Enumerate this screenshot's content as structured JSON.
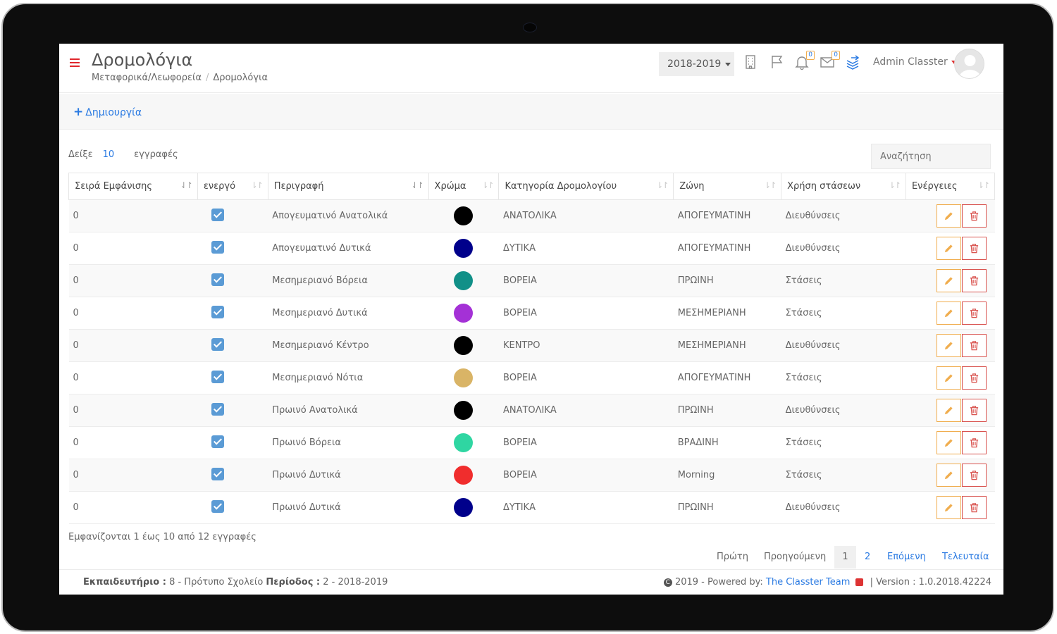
{
  "header": {
    "title": "Δρομολόγια",
    "breadcrumb": [
      "Μεταφορικά/Λεωφορεία",
      "Δρομολόγια"
    ],
    "year": "2018-2019",
    "notifications_count": "0",
    "messages_count": "0",
    "user_name": "Admin Classter"
  },
  "toolbar": {
    "create_label": "Δημιουργία"
  },
  "controls": {
    "show_label": "Δείξε",
    "page_length": "10",
    "entries_label": "εγγραφές",
    "search_placeholder": "Αναζήτηση"
  },
  "table": {
    "columns": [
      "Σειρά Εμφάνισης",
      "ενεργό",
      "Περιγραφή",
      "Χρώμα",
      "Κατηγορία Δρομολογίου",
      "Ζώνη",
      "Χρήση στάσεων",
      "Ενέργειες"
    ],
    "rows": [
      {
        "order": "0",
        "active": true,
        "description": "Απογευματινό Ανατολικά",
        "color": "#000000",
        "category": "ΑΝΑΤΟΛΙΚΑ",
        "zone": "ΑΠΟΓΕΥΜΑΤΙΝΗ",
        "stops": "Διευθύνσεις"
      },
      {
        "order": "0",
        "active": true,
        "description": "Απογευματινό Δυτικά",
        "color": "#00008b",
        "category": "ΔΥΤΙΚΑ",
        "zone": "ΑΠΟΓΕΥΜΑΤΙΝΗ",
        "stops": "Διευθύνσεις"
      },
      {
        "order": "0",
        "active": true,
        "description": "Μεσημεριανό Βόρεια",
        "color": "#119088",
        "category": "ΒΟΡΕΙΑ",
        "zone": "ΠΡΩΙΝΗ",
        "stops": "Στάσεις"
      },
      {
        "order": "0",
        "active": true,
        "description": "Μεσημεριανό Δυτικά",
        "color": "#a431d6",
        "category": "ΒΟΡΕΙΑ",
        "zone": "ΜΕΣΗΜΕΡΙΑΝΗ",
        "stops": "Στάσεις"
      },
      {
        "order": "0",
        "active": true,
        "description": "Μεσημεριανό Κέντρο",
        "color": "#000000",
        "category": "ΚΕΝΤΡΟ",
        "zone": "ΜΕΣΗΜΕΡΙΑΝΗ",
        "stops": "Διευθύνσεις"
      },
      {
        "order": "0",
        "active": true,
        "description": "Μεσημεριανό Νότια",
        "color": "#d9b466",
        "category": "ΒΟΡΕΙΑ",
        "zone": "ΑΠΟΓΕΥΜΑΤΙΝΗ",
        "stops": "Στάσεις"
      },
      {
        "order": "0",
        "active": true,
        "description": "Πρωινό Ανατολικά",
        "color": "#000000",
        "category": "ΑΝΑΤΟΛΙΚΑ",
        "zone": "ΠΡΩΙΝΗ",
        "stops": "Διευθύνσεις"
      },
      {
        "order": "0",
        "active": true,
        "description": "Πρωινό Βόρεια",
        "color": "#2fd6a2",
        "category": "ΒΟΡΕΙΑ",
        "zone": "ΒΡΑΔΙΝΗ",
        "stops": "Στάσεις"
      },
      {
        "order": "0",
        "active": true,
        "description": "Πρωινό Δυτικά",
        "color": "#f02d2d",
        "category": "ΒΟΡΕΙΑ",
        "zone": "Morning",
        "stops": "Στάσεις"
      },
      {
        "order": "0",
        "active": true,
        "description": "Πρωινό Δυτικά",
        "color": "#00008b",
        "category": "ΔΥΤΙΚΑ",
        "zone": "ΠΡΩΙΝΗ",
        "stops": "Διευθύνσεις"
      }
    ]
  },
  "info_text": "Εμφανίζονται 1 έως 10 από 12 εγγραφές",
  "pagination": {
    "first": "Πρώτη",
    "previous": "Προηγούμενη",
    "page1": "1",
    "page2": "2",
    "next": "Επόμενη",
    "last": "Τελευταία"
  },
  "footer": {
    "school_label": "Εκπαιδευτήριο :",
    "school_value": "8 - Πρότυπο Σχολείο",
    "period_label": "Περίοδος :",
    "period_value": "2 - 2018-2019",
    "copyright": "2019 - Powered by:",
    "team": "The Classter Team",
    "version": "| Version : 1.0.2018.42224"
  },
  "colors": {
    "accent": "#2a7ae2",
    "menu": "#e0272c",
    "edit": "#f0ad4e",
    "delete": "#d9534f",
    "checkbox": "#5b9bd5"
  }
}
